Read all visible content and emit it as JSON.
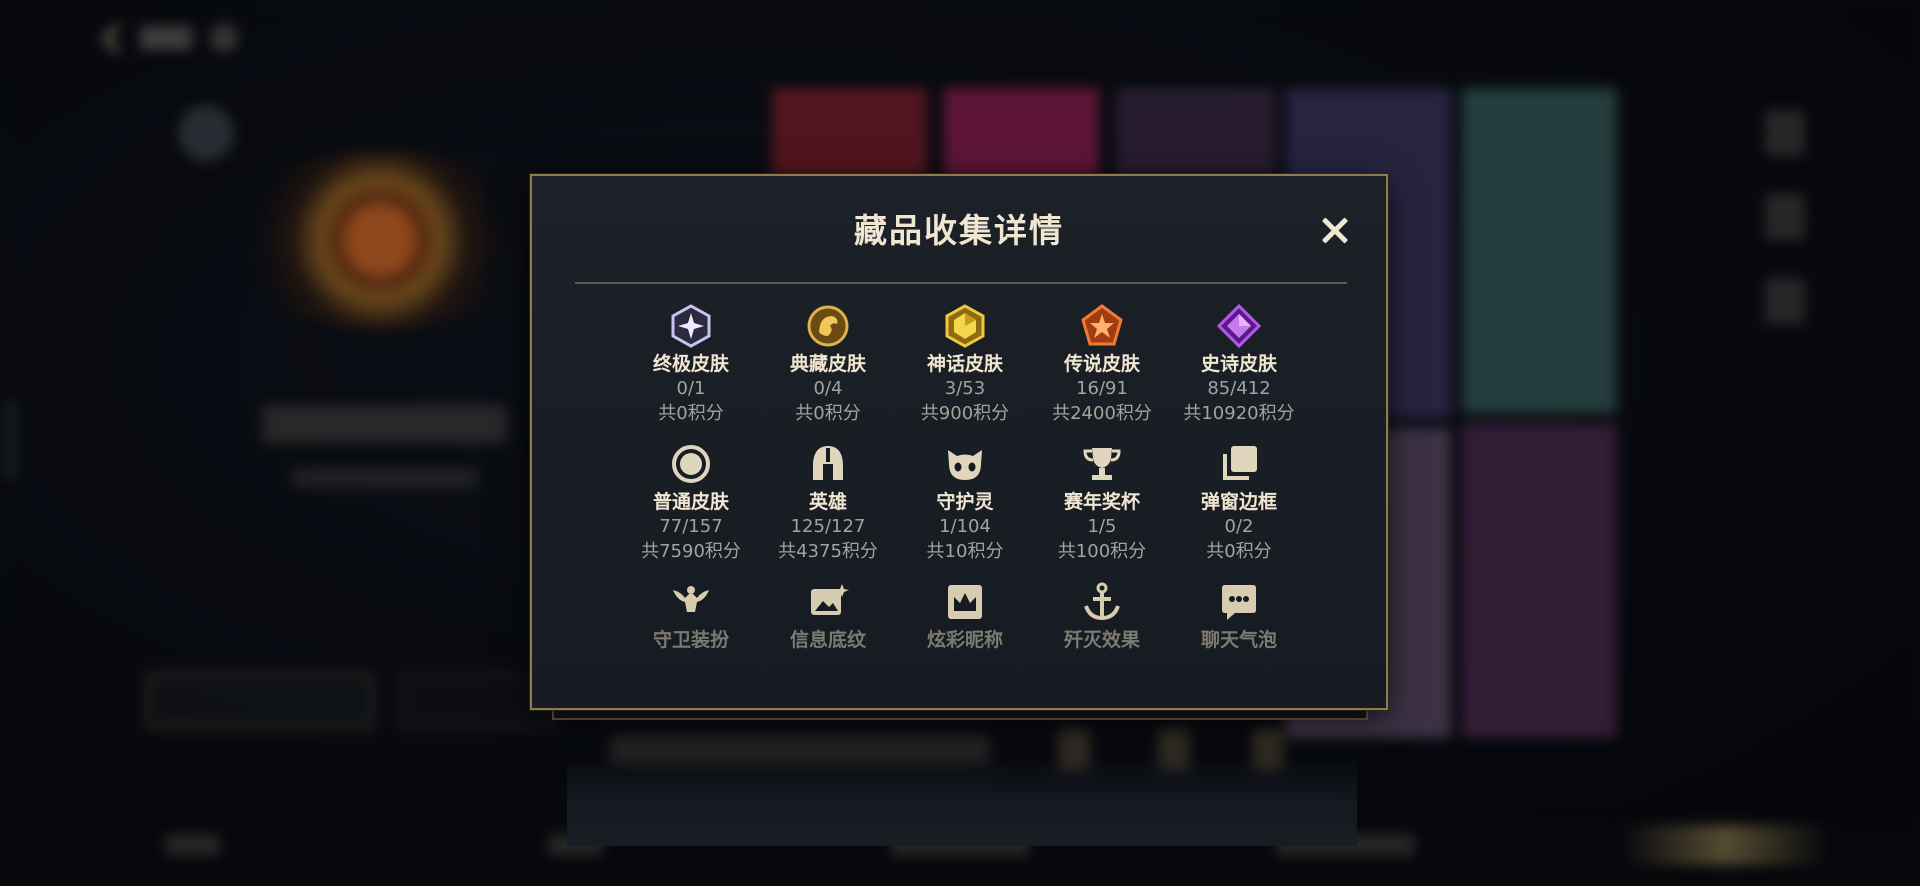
{
  "modal": {
    "title": "藏品收集详情",
    "categories": [
      {
        "label": "终极皮肤",
        "count": "0/1",
        "points": "共0积分",
        "icon": "ultimate-skin-icon",
        "color": "#c9c2ee"
      },
      {
        "label": "典藏皮肤",
        "count": "0/4",
        "points": "共0积分",
        "icon": "prestige-skin-icon",
        "color": "#d9a53a"
      },
      {
        "label": "神话皮肤",
        "count": "3/53",
        "points": "共900积分",
        "icon": "mythic-skin-icon",
        "color": "#e2b62e"
      },
      {
        "label": "传说皮肤",
        "count": "16/91",
        "points": "共2400积分",
        "icon": "legendary-skin-icon",
        "color": "#e2642a"
      },
      {
        "label": "史诗皮肤",
        "count": "85/412",
        "points": "共10920积分",
        "icon": "epic-skin-icon",
        "color": "#9b3fd6"
      },
      {
        "label": "普通皮肤",
        "count": "77/157",
        "points": "共7590积分",
        "icon": "standard-skin-icon",
        "color": "#d8ccb0"
      },
      {
        "label": "英雄",
        "count": "125/127",
        "points": "共4375积分",
        "icon": "champion-helmet-icon",
        "color": "#d8ccb0"
      },
      {
        "label": "守护灵",
        "count": "1/104",
        "points": "共10积分",
        "icon": "guardian-spirit-icon",
        "color": "#d8ccb0"
      },
      {
        "label": "赛年奖杯",
        "count": "1/5",
        "points": "共100积分",
        "icon": "season-trophy-icon",
        "color": "#d8ccb0"
      },
      {
        "label": "弹窗边框",
        "count": "0/2",
        "points": "共0积分",
        "icon": "popup-frame-icon",
        "color": "#d8ccb0"
      },
      {
        "label": "守卫装扮",
        "icon": "ward-skin-icon",
        "color": "#d8ccb0"
      },
      {
        "label": "信息底纹",
        "icon": "info-background-icon",
        "color": "#d8ccb0"
      },
      {
        "label": "炫彩昵称",
        "icon": "nickname-crown-icon",
        "color": "#d8ccb0"
      },
      {
        "label": "歼灭效果",
        "icon": "ace-effect-icon",
        "color": "#d8ccb0"
      },
      {
        "label": "聊天气泡",
        "icon": "chat-bubble-icon",
        "color": "#d8ccb0"
      }
    ]
  },
  "theme": {
    "gold_border": "#8e7b4e",
    "panel_bg": "#1c2128",
    "title_color": "#f0e6d2",
    "muted_text": "#a4a29c"
  }
}
